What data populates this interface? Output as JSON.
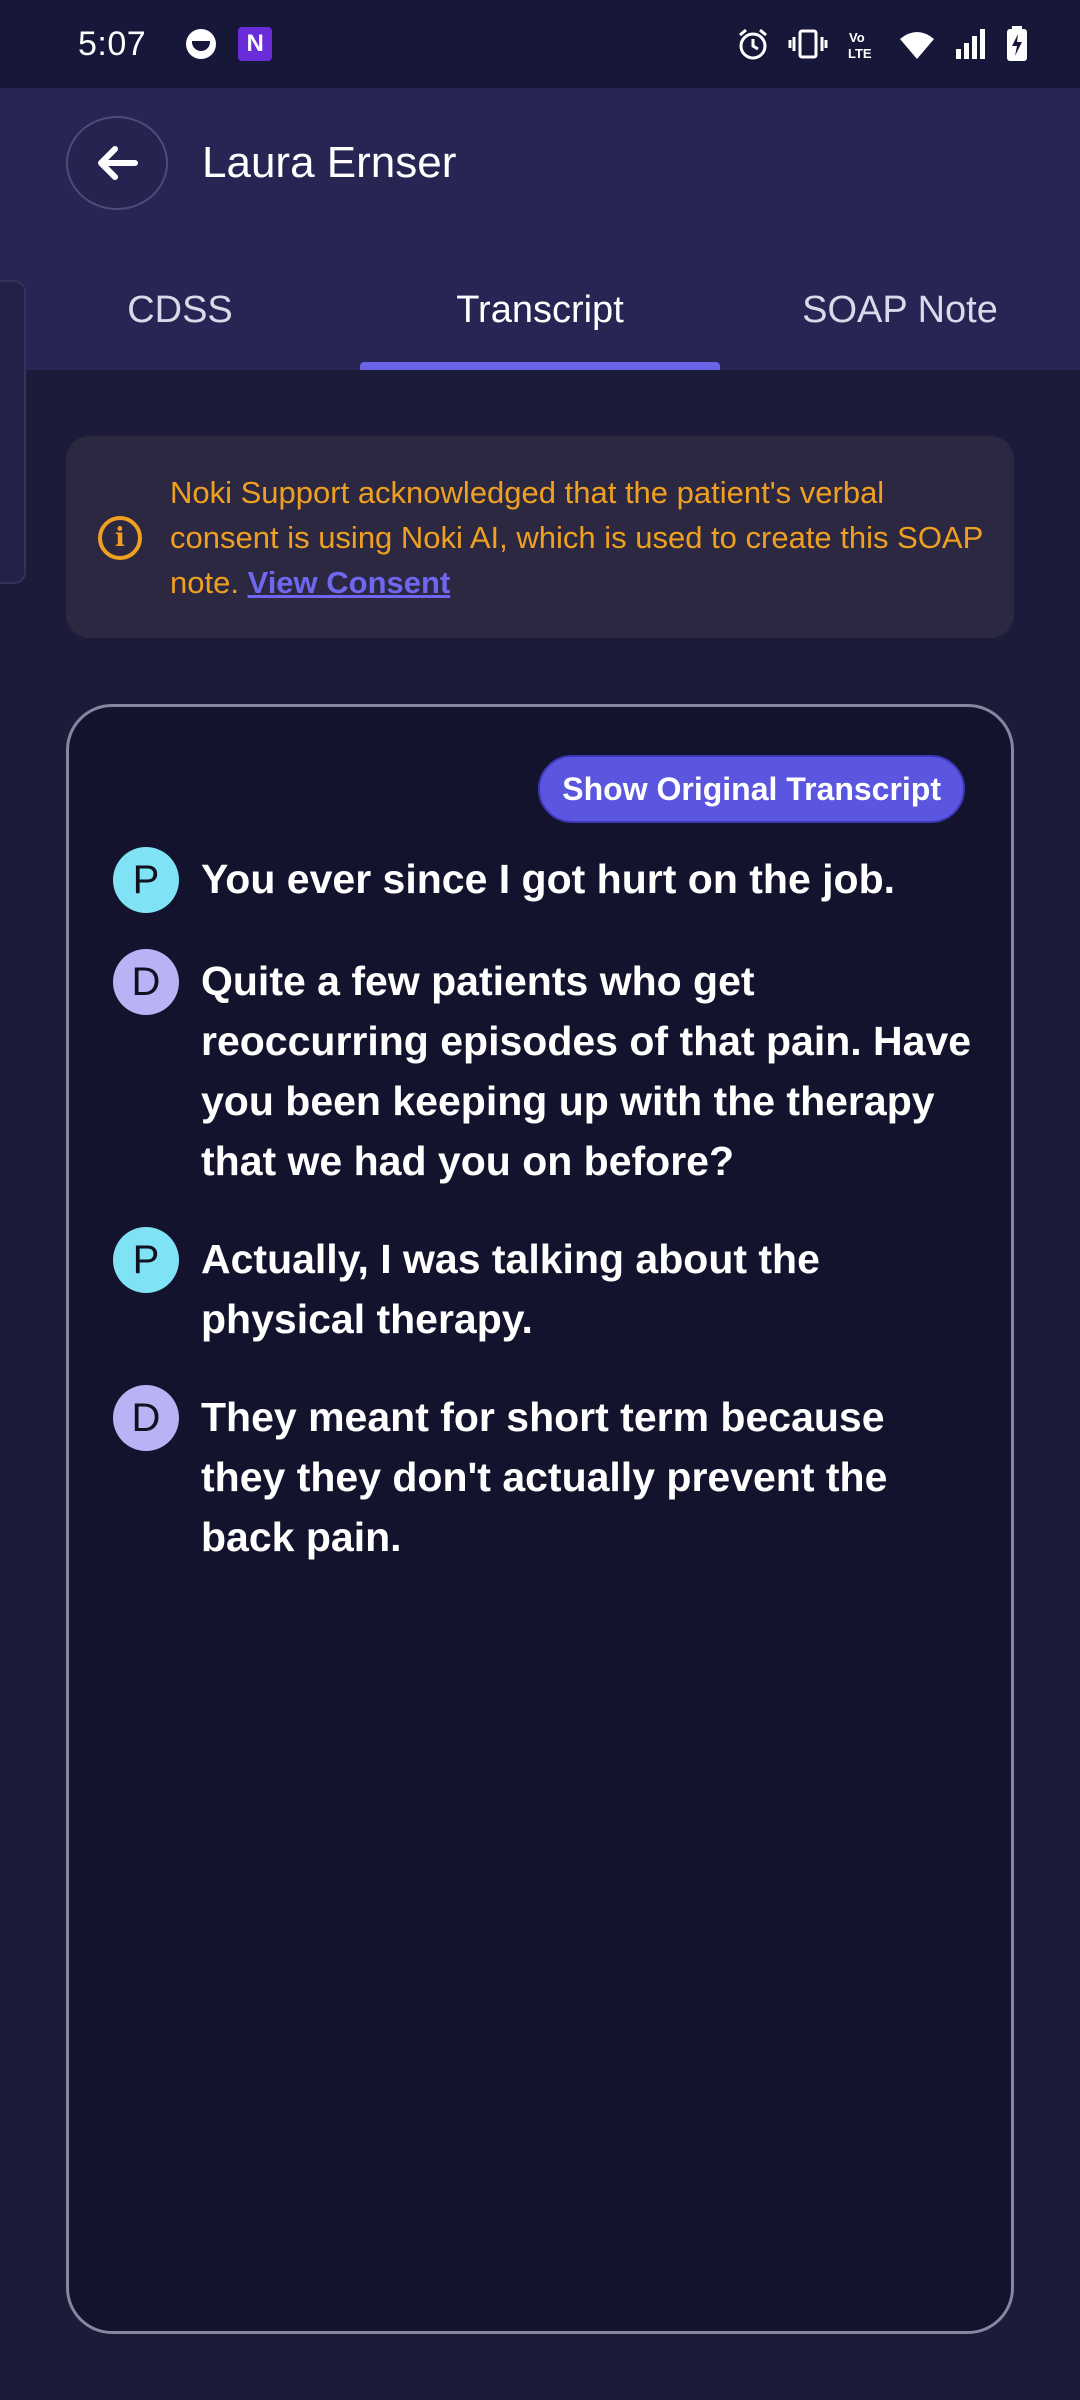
{
  "status_bar": {
    "time": "5:07",
    "left_icons": [
      "notification-face-icon",
      "noki-app-icon"
    ],
    "noki_app_letter": "N",
    "right_icons": [
      "alarm-icon",
      "vibrate-icon",
      "volte-icon",
      "wifi-icon",
      "signal-icon",
      "battery-charging-icon"
    ]
  },
  "header": {
    "patient_name": "Laura Ernser",
    "tabs": [
      {
        "label": "CDSS",
        "active": false
      },
      {
        "label": "Transcript",
        "active": true
      },
      {
        "label": "SOAP Note",
        "active": false
      }
    ]
  },
  "consent": {
    "icon": "info-icon",
    "icon_glyph": "i",
    "text": "Noki Support acknowledged that the patient's verbal consent is using Noki AI, which is used to create this SOAP note.",
    "link_label": "View Consent",
    "color": "#f0a020"
  },
  "transcript": {
    "show_original_label": "Show Original Transcript",
    "lines": [
      {
        "speaker": "P",
        "text": "You ever since I got hurt on the job."
      },
      {
        "speaker": "D",
        "text": "Quite a few patients who get reoccurring episodes of that pain. Have you been keeping up with the therapy that we had you on before?"
      },
      {
        "speaker": "P",
        "text": "Actually, I was talking about the physical therapy."
      },
      {
        "speaker": "D",
        "text": "They meant for short term because they they don't actually prevent the back pain."
      }
    ]
  },
  "colors": {
    "accent": "#6a63e8",
    "patient_avatar": "#7fe3f5",
    "doctor_avatar": "#b7b3f4",
    "background": "#1c1b3a"
  }
}
